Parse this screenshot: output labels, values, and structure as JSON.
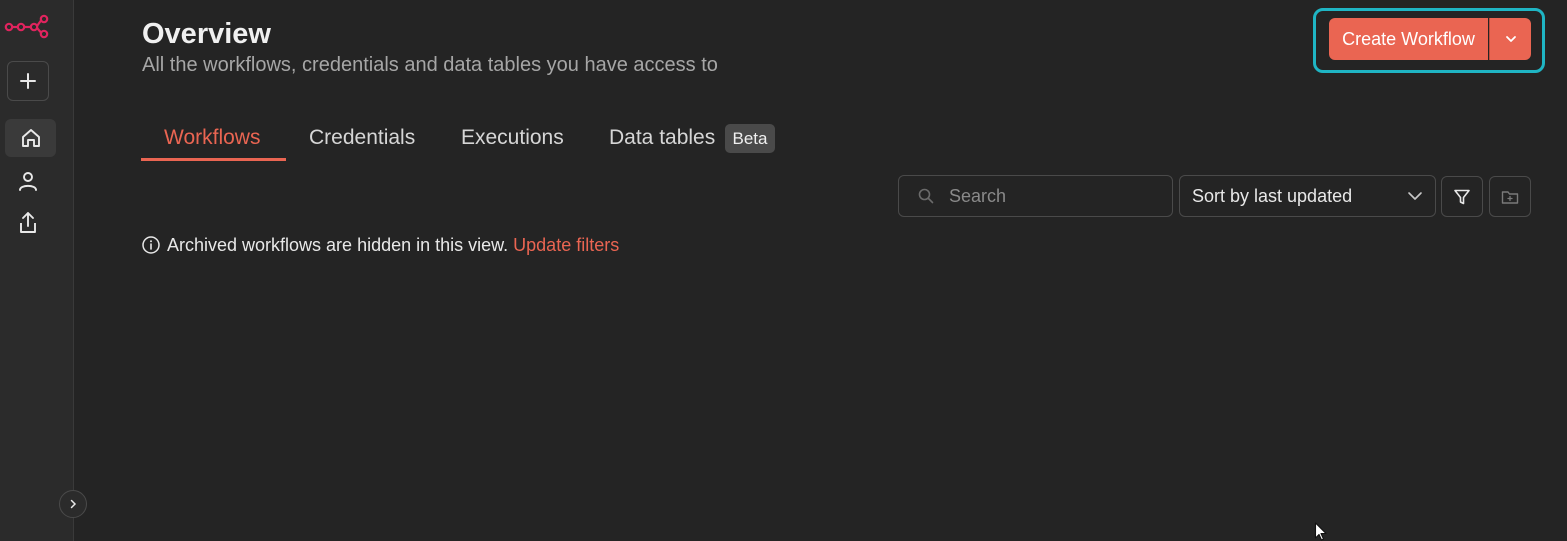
{
  "header": {
    "title": "Overview",
    "subtitle": "All the workflows, credentials and data tables you have access to"
  },
  "actions": {
    "create_label": "Create Workflow"
  },
  "tabs": [
    {
      "label": "Workflows",
      "active": true
    },
    {
      "label": "Credentials",
      "active": false
    },
    {
      "label": "Executions",
      "active": false
    },
    {
      "label": "Data tables",
      "active": false,
      "badge": "Beta"
    }
  ],
  "toolbar": {
    "search_placeholder": "Search",
    "sort_label": "Sort by last updated"
  },
  "info": {
    "message": "Archived workflows are hidden in this view.",
    "link": "Update filters"
  },
  "colors": {
    "accent": "#ea6552",
    "focus_ring": "#1fb5c4",
    "background": "#242424",
    "sidebar": "#2b2b2b",
    "logo": "#e0245e"
  },
  "icons": {
    "logo": "n8n-logo-icon",
    "add": "plus-icon",
    "home": "home-icon",
    "user": "user-icon",
    "share": "share-icon",
    "collapse": "chevron-right-icon",
    "search": "search-icon",
    "sort": "chevron-down-icon",
    "filter": "filter-icon",
    "folder": "folder-add-icon",
    "info": "info-icon"
  }
}
